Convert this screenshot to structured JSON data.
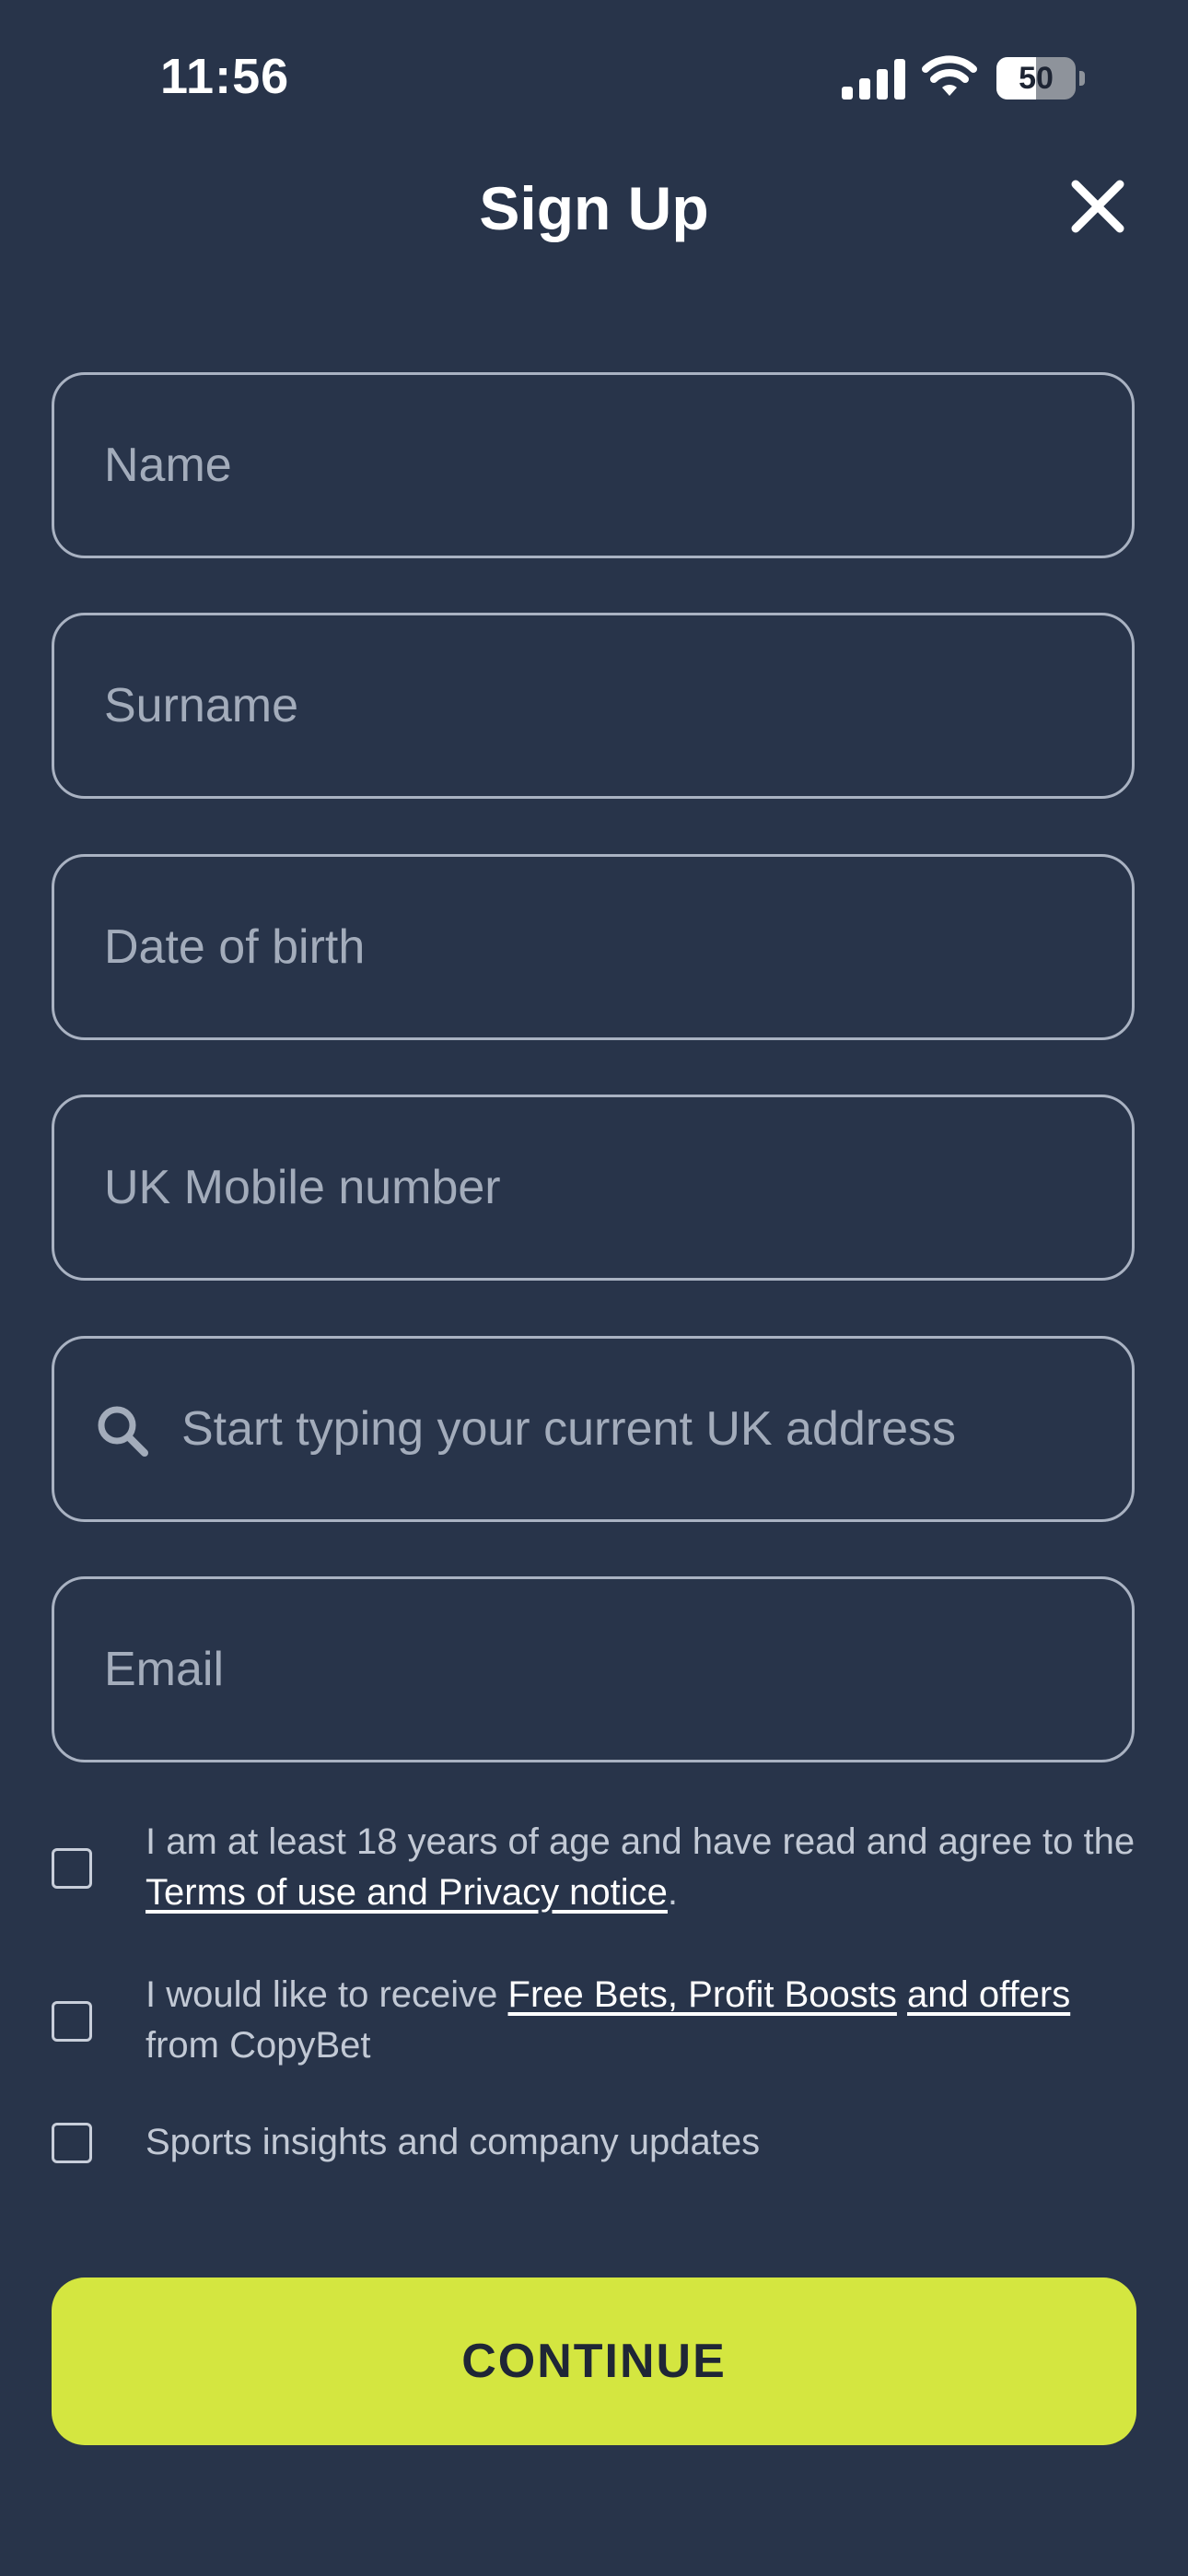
{
  "status_bar": {
    "time": "11:56",
    "battery_level": "50",
    "battery_fraction": 0.5
  },
  "header": {
    "title": "Sign Up",
    "close_icon": "close-icon"
  },
  "form": {
    "name_placeholder": "Name",
    "surname_placeholder": "Surname",
    "dob_placeholder": "Date of birth",
    "mobile_placeholder": "UK Mobile number",
    "address_placeholder": "Start typing your current UK address",
    "address_icon": "search-icon",
    "email_placeholder": "Email"
  },
  "consents": {
    "age": {
      "checked": false,
      "text_before": "I am at least 18 years of age and have read and agree to the ",
      "link": "Terms of use and Privacy notice",
      "text_after": "."
    },
    "offers": {
      "checked": false,
      "text_before": "I would like to receive ",
      "link": "Free Bets, Profit Boosts",
      "link_2": "and offers",
      "text_after": " from CopyBet"
    },
    "updates": {
      "checked": false,
      "text": "Sports insights and company updates"
    }
  },
  "continue_label": "CONTINUE",
  "colors": {
    "background": "#28344a",
    "accent": "#d4e640",
    "field_border": "#a9b2c2",
    "placeholder": "#a3acbb"
  }
}
